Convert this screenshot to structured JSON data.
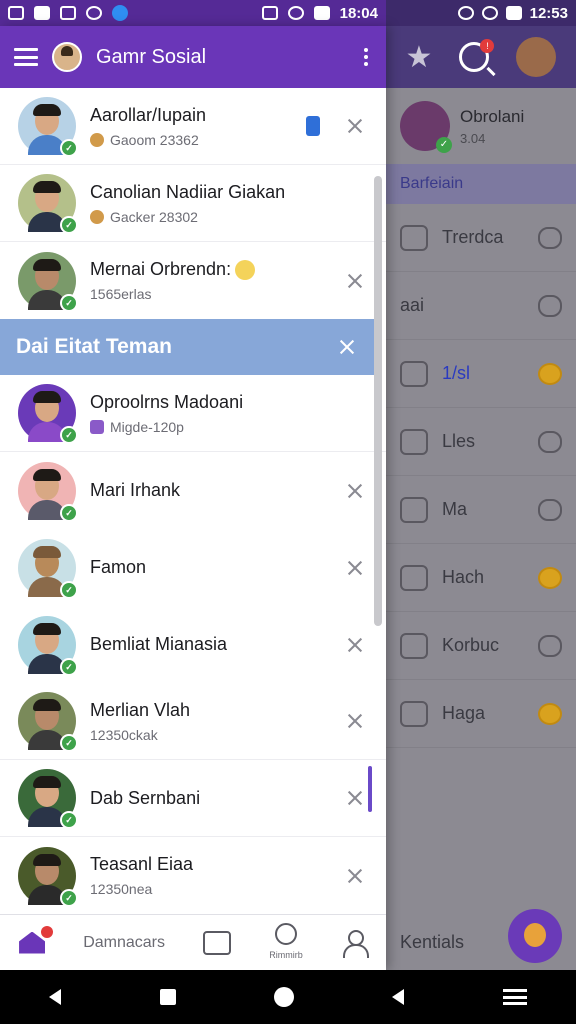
{
  "status_left": {
    "time": "18:04"
  },
  "status_right": {
    "time": "12:53"
  },
  "appbar": {
    "title": "Gamr Sosial"
  },
  "drawer_items_top": [
    {
      "name": "Aarollar/Iupain",
      "sub": "Gaoom 23362",
      "has_close": true,
      "has_notif": true
    },
    {
      "name": "Canolian Nadiiar Giakan",
      "sub": "Gacker 28302",
      "has_close": false,
      "has_notif": false
    },
    {
      "name": "Mernai Orbrendn:",
      "sub": "1565erlas",
      "has_close": true,
      "has_notif": false
    }
  ],
  "section": {
    "title": "Dai Eitat Teman"
  },
  "drawer_items_bottom": [
    {
      "name": "Oproolrns Madoani",
      "sub": "Migde-120p",
      "has_close": false
    },
    {
      "name": "Mari Irhank",
      "sub": "",
      "has_close": true
    },
    {
      "name": "Famon",
      "sub": "",
      "has_close": true
    },
    {
      "name": "Bemliat Mianasia",
      "sub": "",
      "has_close": true
    },
    {
      "name": "Merlian Vlah",
      "sub": "12350ckak",
      "has_close": true
    },
    {
      "name": "Dab Sernbani",
      "sub": "",
      "has_close": true
    },
    {
      "name": "Teasanl Eiaa",
      "sub": "12350nea",
      "has_close": true
    }
  ],
  "bottom_nav": {
    "label": "Damnacars",
    "clock_label": "Rimmirb"
  },
  "right_panel": {
    "profile_name": "Obrolani",
    "profile_sub": "3.04",
    "section": "Barfeiain",
    "rows": [
      {
        "label": "Trerdca"
      },
      {
        "label": "aai"
      },
      {
        "label": "1/sl"
      },
      {
        "label": "Lles"
      },
      {
        "label": "Ma"
      },
      {
        "label": "Hach"
      },
      {
        "label": "Korbuc"
      },
      {
        "label": "Haga"
      }
    ],
    "bottom_label": "Kentials"
  },
  "colors": {
    "accent": "#6a36b8",
    "section": "#87a7d8",
    "online": "#3ea24a"
  }
}
